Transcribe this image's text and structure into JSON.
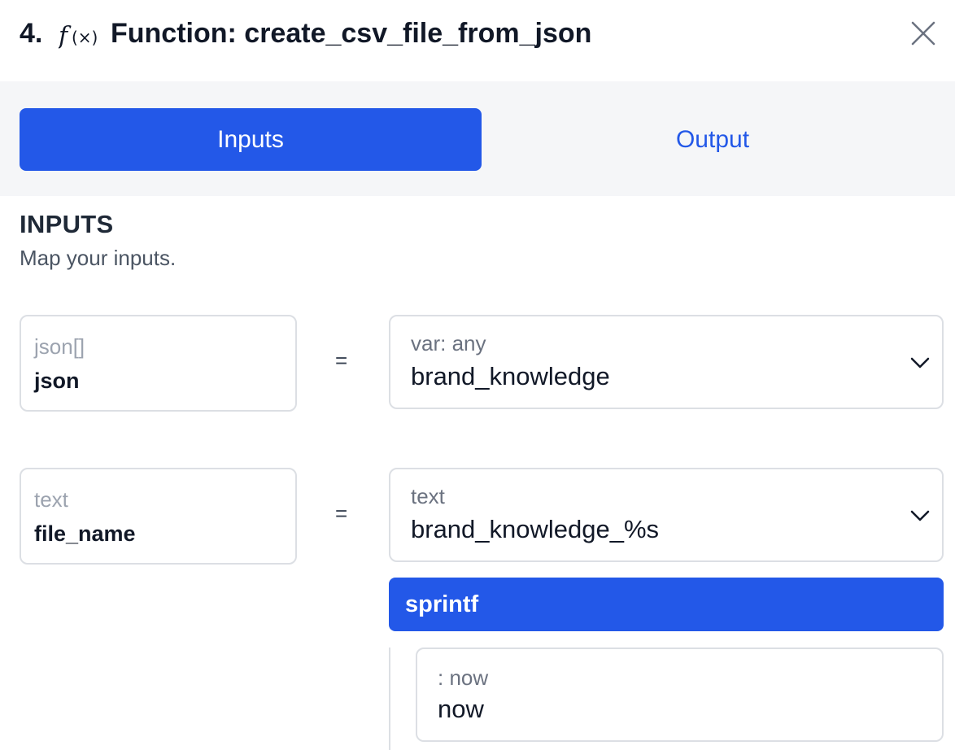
{
  "header": {
    "step_number": "4.",
    "icon": "function-icon",
    "title": "Function: create_csv_file_from_json",
    "close_icon": "close-icon"
  },
  "tabs": [
    {
      "label": "Inputs",
      "active": true
    },
    {
      "label": "Output",
      "active": false
    }
  ],
  "inputs_section": {
    "title": "INPUTS",
    "subtitle": "Map your inputs."
  },
  "mappings": [
    {
      "param_type": "json[]",
      "param_name": "json",
      "operator": "=",
      "value_type": "var: any",
      "value": "brand_knowledge"
    },
    {
      "param_type": "text",
      "param_name": "file_name",
      "operator": "=",
      "value_type": "text",
      "value": "brand_knowledge_%s"
    }
  ],
  "filter": {
    "name": "sprintf",
    "args": [
      {
        "label": ": now",
        "value": "now"
      }
    ]
  },
  "colors": {
    "accent": "#2358e8",
    "tab_bar_bg": "#f5f6f8",
    "border": "#dcdfe4"
  }
}
